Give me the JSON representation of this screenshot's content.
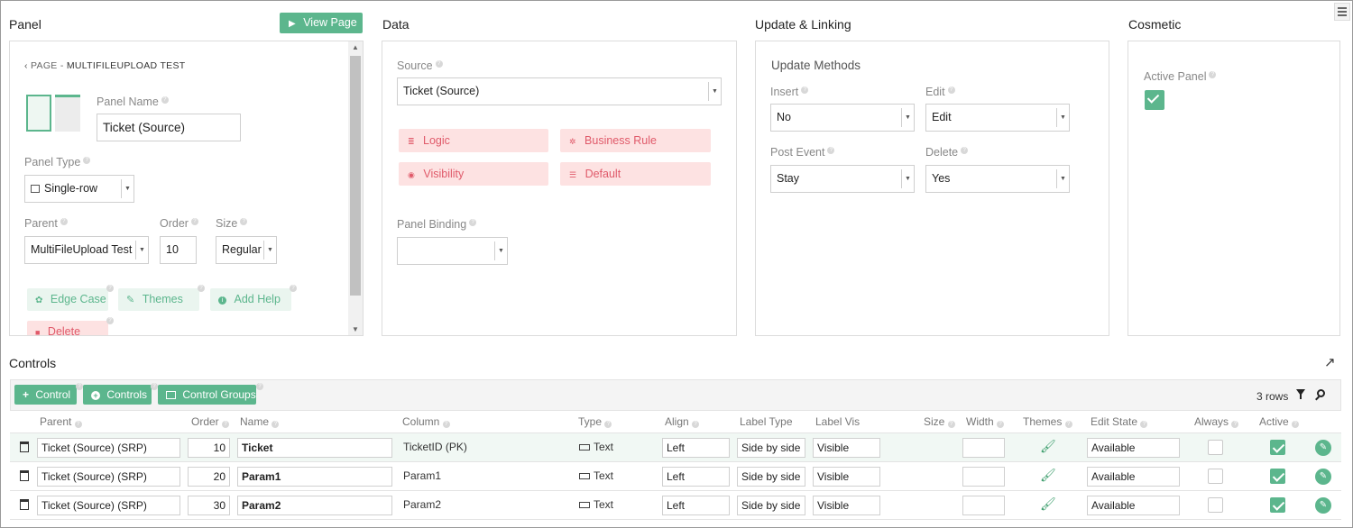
{
  "panel": {
    "title": "Panel",
    "view_page": "View Page",
    "breadcrumb_prefix": "PAGE -",
    "breadcrumb_name": "MULTIFILEUPLOAD TEST",
    "panel_name_label": "Panel Name",
    "panel_name_value": "Ticket (Source)",
    "panel_type_label": "Panel Type",
    "panel_type_value": "Single-row",
    "parent_label": "Parent",
    "parent_value": "MultiFileUpload Test",
    "order_label": "Order",
    "order_value": "10",
    "size_label": "Size",
    "size_value": "Regular",
    "edge_case": "Edge Case",
    "themes": "Themes",
    "add_help": "Add Help",
    "delete": "Delete"
  },
  "data_section": {
    "title": "Data",
    "source_label": "Source",
    "source_value": "Ticket (Source)",
    "logic": "Logic",
    "business_rule": "Business Rule",
    "visibility": "Visibility",
    "default": "Default",
    "panel_binding_label": "Panel Binding",
    "panel_binding_value": ""
  },
  "update": {
    "title": "Update & Linking",
    "methods_title": "Update Methods",
    "insert_label": "Insert",
    "insert_value": "No",
    "edit_label": "Edit",
    "edit_value": "Edit",
    "post_event_label": "Post Event",
    "post_event_value": "Stay",
    "delete_label": "Delete",
    "delete_value": "Yes"
  },
  "cosmetic": {
    "title": "Cosmetic",
    "active_panel_label": "Active Panel",
    "active_panel_checked": true
  },
  "controls": {
    "title": "Controls",
    "add_control": "Control",
    "add_controls": "Controls",
    "control_groups": "Control Groups",
    "row_count": "3 rows",
    "headers": {
      "parent": "Parent",
      "order": "Order",
      "name": "Name",
      "column": "Column",
      "type": "Type",
      "align": "Align",
      "label_type": "Label Type",
      "label_vis": "Label Vis",
      "size": "Size",
      "width": "Width",
      "themes": "Themes",
      "edit_state": "Edit State",
      "always": "Always",
      "active": "Active"
    },
    "rows": [
      {
        "parent": "Ticket (Source) (SRP)",
        "order": "10",
        "name": "Ticket",
        "column": "TicketID (PK)",
        "type": "Text",
        "align": "Left",
        "label_type": "Side by side",
        "label_vis": "Visible",
        "width": "",
        "edit_state": "Available",
        "always": false,
        "active": true
      },
      {
        "parent": "Ticket (Source) (SRP)",
        "order": "20",
        "name": "Param1",
        "column": "Param1",
        "type": "Text",
        "align": "Left",
        "label_type": "Side by side",
        "label_vis": "Visible",
        "width": "",
        "edit_state": "Available",
        "always": false,
        "active": true
      },
      {
        "parent": "Ticket (Source) (SRP)",
        "order": "30",
        "name": "Param2",
        "column": "Param2",
        "type": "Text",
        "align": "Left",
        "label_type": "Side by side",
        "label_vis": "Visible",
        "width": "",
        "edit_state": "Available",
        "always": false,
        "active": true
      }
    ]
  },
  "colors": {
    "accent": "#5cb68d",
    "danger": "#e05a6a"
  }
}
